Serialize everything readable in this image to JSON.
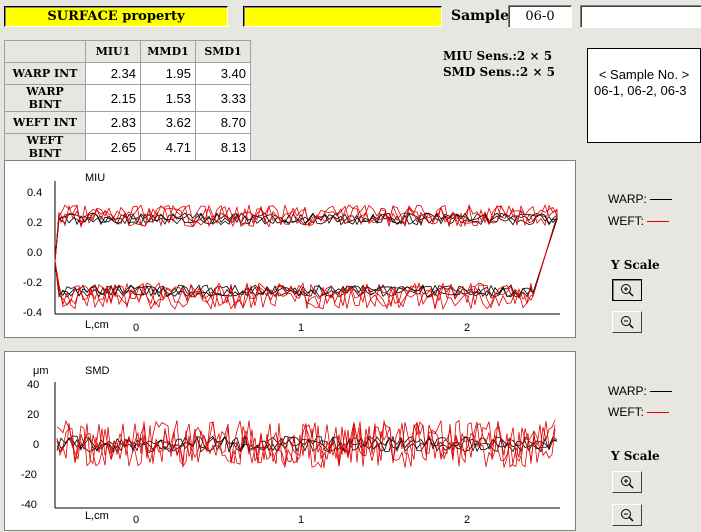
{
  "header": {
    "title": "SURFACE  property",
    "sample_label": "Sample",
    "sample_value": "06-0"
  },
  "table": {
    "columns": [
      "MIU1",
      "MMD1",
      "SMD1"
    ],
    "rows": [
      {
        "label": "WARP INT",
        "values": [
          "2.34",
          "1.95",
          "3.40"
        ]
      },
      {
        "label": "WARP BINT",
        "values": [
          "2.15",
          "1.53",
          "3.33"
        ]
      },
      {
        "label": "WEFT INT",
        "values": [
          "2.83",
          "3.62",
          "8.70"
        ]
      },
      {
        "label": "WEFT BINT",
        "values": [
          "2.65",
          "4.71",
          "8.13"
        ]
      }
    ]
  },
  "sensitivity": {
    "miu": "MIU Sens.:2 × 5",
    "smd": "SMD Sens.:2 × 5"
  },
  "note": {
    "line1": "< Sample No. >",
    "line2": "06-1, 06-2, 06-3"
  },
  "colors": {
    "warp": "#000000",
    "weft": "#e00000"
  },
  "miu_chart": {
    "label": "MIU",
    "yticks": [
      "0.4",
      "0.2",
      "0.0",
      "-0.2",
      "-0.4"
    ],
    "xticks": [
      "0",
      "1",
      "2"
    ],
    "xunit": "L,cm"
  },
  "smd_chart": {
    "label": "SMD",
    "yunit": "μm",
    "yticks": [
      "40",
      "20",
      "0",
      "-20",
      "-40"
    ],
    "xticks": [
      "0",
      "1",
      "2"
    ],
    "xunit": "L,cm"
  },
  "legend": {
    "warp": "WARP:",
    "weft": "WEFT:"
  },
  "yscale_label": "Y Scale",
  "icons": {
    "zoom_in": "zoom-in-icon",
    "zoom_out": "zoom-out-icon"
  }
}
